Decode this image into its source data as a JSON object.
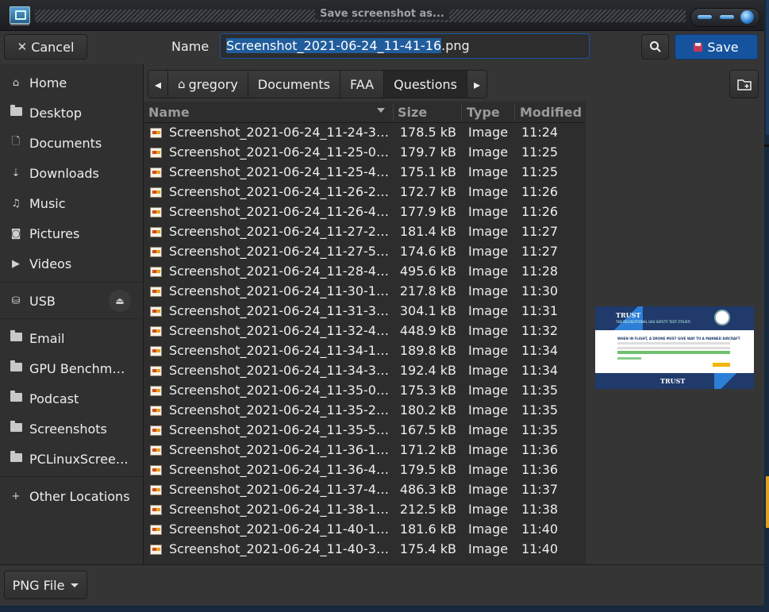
{
  "window": {
    "title": "Save screenshot as..."
  },
  "header": {
    "cancel_label": "Cancel",
    "name_label": "Name",
    "filename_selected": "Screenshot_2021-06-24_11-41-16",
    "filename_ext": ".png",
    "save_label": "Save"
  },
  "sidebar": {
    "items": [
      {
        "label": "Home",
        "icon": "home-icon"
      },
      {
        "label": "Desktop",
        "icon": "folder-icon"
      },
      {
        "label": "Documents",
        "icon": "document-icon"
      },
      {
        "label": "Downloads",
        "icon": "download-icon"
      },
      {
        "label": "Music",
        "icon": "music-icon"
      },
      {
        "label": "Pictures",
        "icon": "camera-icon"
      },
      {
        "label": "Videos",
        "icon": "video-icon"
      },
      {
        "label": "USB",
        "icon": "drive-icon"
      },
      {
        "label": "Email",
        "icon": "folder-icon"
      },
      {
        "label": "GPU Benchm…",
        "icon": "folder-icon"
      },
      {
        "label": "Podcast",
        "icon": "folder-icon"
      },
      {
        "label": "Screenshots",
        "icon": "folder-icon"
      },
      {
        "label": "PCLinuxScree…",
        "icon": "folder-icon"
      },
      {
        "label": "Other Locations",
        "icon": "plus-icon"
      }
    ]
  },
  "pathbar": {
    "crumbs": [
      "gregory",
      "Documents",
      "FAA",
      "Questions"
    ]
  },
  "file_list": {
    "columns": [
      "Name",
      "Size",
      "Type",
      "Modified"
    ],
    "rows": [
      {
        "name": "Screenshot_2021-06-24_11-24-3…",
        "size": "178.5 kB",
        "type": "Image",
        "modified": "11:24"
      },
      {
        "name": "Screenshot_2021-06-24_11-25-0…",
        "size": "179.7 kB",
        "type": "Image",
        "modified": "11:25"
      },
      {
        "name": "Screenshot_2021-06-24_11-25-4…",
        "size": "175.1 kB",
        "type": "Image",
        "modified": "11:25"
      },
      {
        "name": "Screenshot_2021-06-24_11-26-2…",
        "size": "172.7 kB",
        "type": "Image",
        "modified": "11:26"
      },
      {
        "name": "Screenshot_2021-06-24_11-26-4…",
        "size": "177.9 kB",
        "type": "Image",
        "modified": "11:26"
      },
      {
        "name": "Screenshot_2021-06-24_11-27-2…",
        "size": "181.4 kB",
        "type": "Image",
        "modified": "11:27"
      },
      {
        "name": "Screenshot_2021-06-24_11-27-5…",
        "size": "174.6 kB",
        "type": "Image",
        "modified": "11:27"
      },
      {
        "name": "Screenshot_2021-06-24_11-28-4…",
        "size": "495.6 kB",
        "type": "Image",
        "modified": "11:28"
      },
      {
        "name": "Screenshot_2021-06-24_11-30-1…",
        "size": "217.8 kB",
        "type": "Image",
        "modified": "11:30"
      },
      {
        "name": "Screenshot_2021-06-24_11-31-3…",
        "size": "304.1 kB",
        "type": "Image",
        "modified": "11:31"
      },
      {
        "name": "Screenshot_2021-06-24_11-32-4…",
        "size": "448.9 kB",
        "type": "Image",
        "modified": "11:32"
      },
      {
        "name": "Screenshot_2021-06-24_11-34-1…",
        "size": "189.8 kB",
        "type": "Image",
        "modified": "11:34"
      },
      {
        "name": "Screenshot_2021-06-24_11-34-3…",
        "size": "192.4 kB",
        "type": "Image",
        "modified": "11:34"
      },
      {
        "name": "Screenshot_2021-06-24_11-35-0…",
        "size": "175.3 kB",
        "type": "Image",
        "modified": "11:35"
      },
      {
        "name": "Screenshot_2021-06-24_11-35-2…",
        "size": "180.2 kB",
        "type": "Image",
        "modified": "11:35"
      },
      {
        "name": "Screenshot_2021-06-24_11-35-5…",
        "size": "167.5 kB",
        "type": "Image",
        "modified": "11:35"
      },
      {
        "name": "Screenshot_2021-06-24_11-36-1…",
        "size": "171.2 kB",
        "type": "Image",
        "modified": "11:36"
      },
      {
        "name": "Screenshot_2021-06-24_11-36-4…",
        "size": "179.5 kB",
        "type": "Image",
        "modified": "11:36"
      },
      {
        "name": "Screenshot_2021-06-24_11-37-4…",
        "size": "486.3 kB",
        "type": "Image",
        "modified": "11:37"
      },
      {
        "name": "Screenshot_2021-06-24_11-38-1…",
        "size": "212.5 kB",
        "type": "Image",
        "modified": "11:38"
      },
      {
        "name": "Screenshot_2021-06-24_11-40-1…",
        "size": "181.6 kB",
        "type": "Image",
        "modified": "11:40"
      },
      {
        "name": "Screenshot_2021-06-24_11-40-3…",
        "size": "175.4 kB",
        "type": "Image",
        "modified": "11:40"
      }
    ]
  },
  "preview": {
    "logo_top": "TRUST",
    "logo_bottom": "TRUST",
    "subtitle": "THE RECREATIONAL UAS SAFETY TEST (TRUST)",
    "question": "WHEN IN FLIGHT, A DRONE MUST GIVE WAY TO A MANNED AIRCRAFT"
  },
  "footer": {
    "filter_label": "PNG File"
  },
  "colors": {
    "accent": "#15539e",
    "selection": "#215d9c",
    "background": "#353535"
  }
}
